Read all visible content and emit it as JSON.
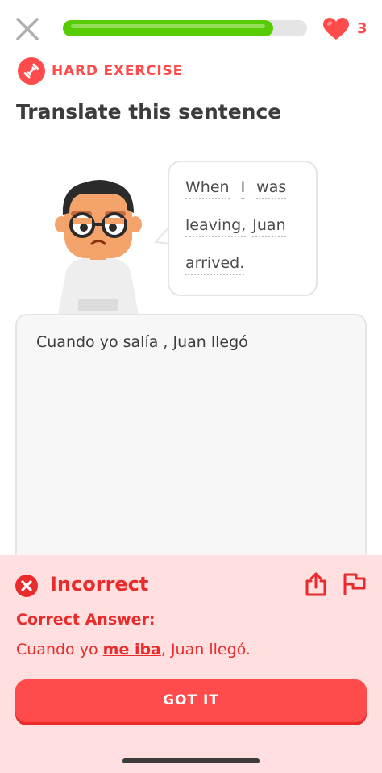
{
  "header": {
    "progress_fraction": 0.86,
    "hearts": "3"
  },
  "exercise": {
    "difficulty": "HARD EXERCISE",
    "instruction": "Translate this sentence"
  },
  "prompt": {
    "line1": [
      "When",
      "I",
      "was"
    ],
    "line2": [
      "leaving,",
      "Juan"
    ],
    "line3": [
      "arrived."
    ]
  },
  "answer": {
    "value": "Cuando yo salía , Juan llegó"
  },
  "feedback": {
    "status": "Incorrect",
    "correct_label": "Correct Answer:",
    "correct_prefix": "Cuando yo ",
    "correct_highlight": "me iba",
    "correct_suffix": ", Juan llegó.",
    "button_label": "GOT IT"
  },
  "colors": {
    "accent_red": "#ff4b4b",
    "error_red": "#ea2b2b",
    "progress_green": "#58cc02",
    "feedback_bg": "#ffdfe0"
  },
  "icons": [
    "close-icon",
    "heart-icon",
    "dumbbell-icon",
    "x-circle-icon",
    "share-icon",
    "flag-icon"
  ]
}
